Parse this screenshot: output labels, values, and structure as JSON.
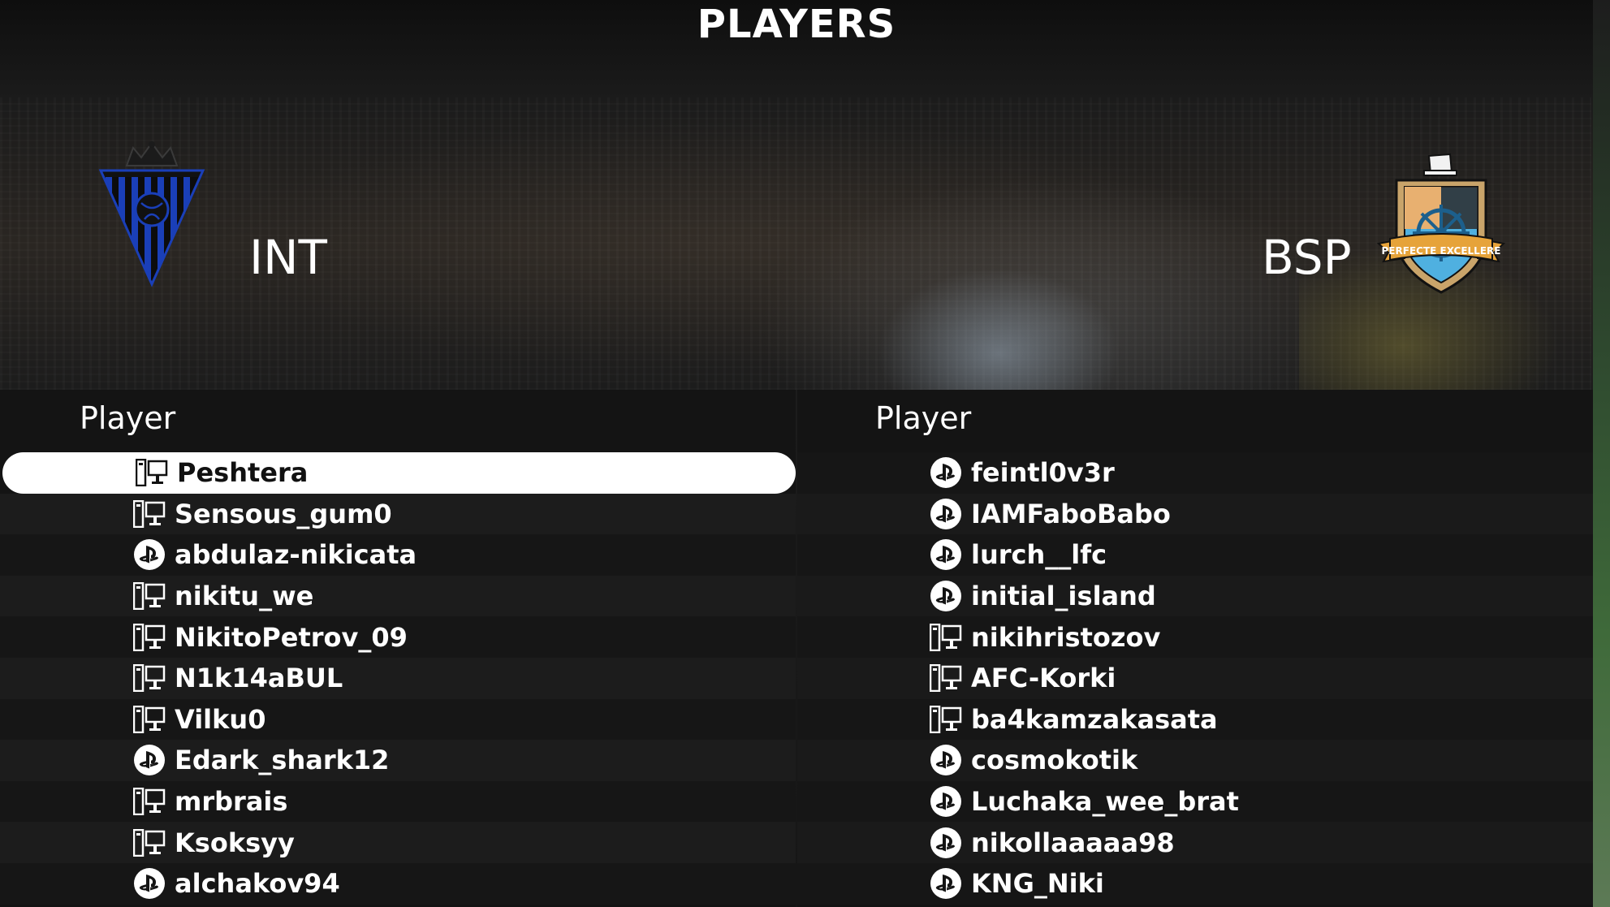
{
  "screen": {
    "title": "PLAYERS"
  },
  "teams": {
    "home": {
      "name": "INT",
      "column_header": "Player",
      "accent": "#1a3fb8"
    },
    "away": {
      "name": "BSP",
      "column_header": "Player",
      "accent": "#3aa0d8",
      "crest_motto": "PERFECTE EXCELLERE"
    }
  },
  "home_players": [
    {
      "name": "Peshtera",
      "platform": "pc-icon",
      "selected": true
    },
    {
      "name": "Sensous_gum0",
      "platform": "pc-icon"
    },
    {
      "name": "abdulaz-nikicata",
      "platform": "playstation-icon"
    },
    {
      "name": "nikitu_we",
      "platform": "pc-icon"
    },
    {
      "name": "NikitoPetrov_09",
      "platform": "pc-icon"
    },
    {
      "name": "N1k14aBUL",
      "platform": "pc-icon"
    },
    {
      "name": "Vilku0",
      "platform": "pc-icon"
    },
    {
      "name": "Edark_shark12",
      "platform": "playstation-icon"
    },
    {
      "name": "mrbrais",
      "platform": "pc-icon"
    },
    {
      "name": "Ksoksyy",
      "platform": "pc-icon"
    },
    {
      "name": "alchakov94",
      "platform": "playstation-icon"
    }
  ],
  "away_players": [
    {
      "name": "feintl0v3r",
      "platform": "playstation-icon"
    },
    {
      "name": "IAMFaboBabo",
      "platform": "playstation-icon"
    },
    {
      "name": "lurch__lfc",
      "platform": "playstation-icon"
    },
    {
      "name": "initial_island",
      "platform": "playstation-icon"
    },
    {
      "name": "nikihristozov",
      "platform": "pc-icon"
    },
    {
      "name": "AFC-Korki",
      "platform": "pc-icon"
    },
    {
      "name": "ba4kamzakasata",
      "platform": "pc-icon"
    },
    {
      "name": "cosmokotik",
      "platform": "playstation-icon"
    },
    {
      "name": "Luchaka_wee_brat",
      "platform": "playstation-icon"
    },
    {
      "name": "nikollaaaaa98",
      "platform": "playstation-icon"
    },
    {
      "name": "KNG_Niki",
      "platform": "playstation-icon"
    }
  ]
}
